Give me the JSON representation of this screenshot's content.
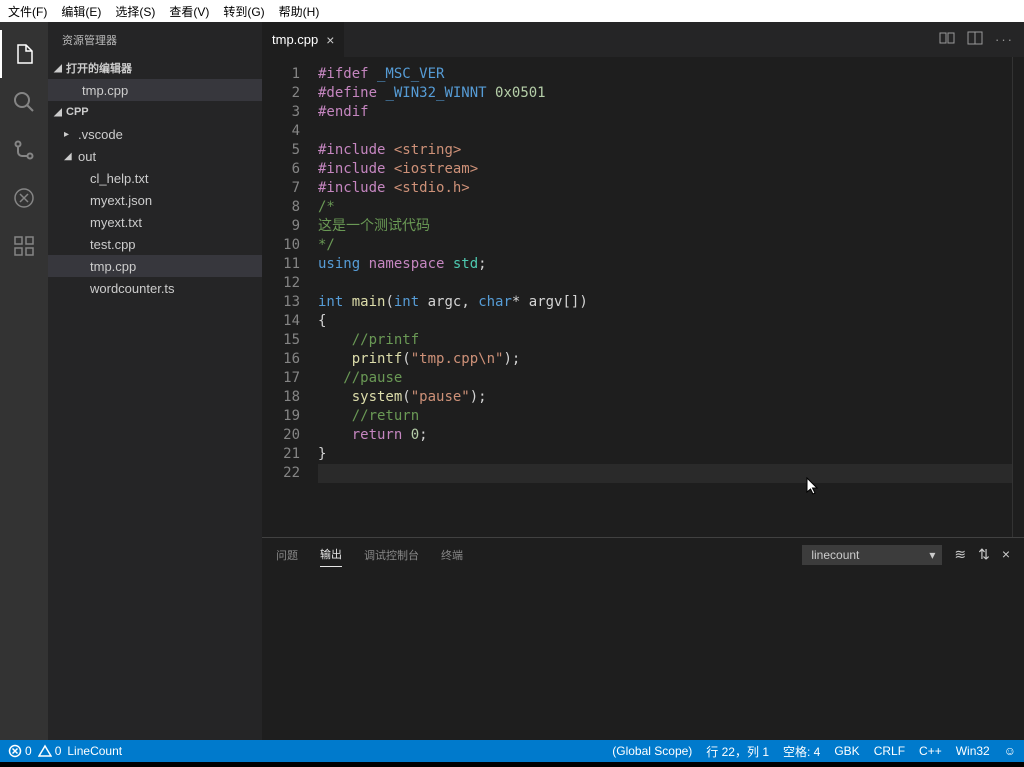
{
  "menubar": [
    "文件(F)",
    "编辑(E)",
    "选择(S)",
    "查看(V)",
    "转到(G)",
    "帮助(H)"
  ],
  "sidebar": {
    "title": "资源管理器",
    "openEditors": {
      "label": "打开的编辑器",
      "items": [
        "tmp.cpp"
      ]
    },
    "workspace": {
      "label": "CPP",
      "tree": [
        {
          "label": ".vscode",
          "type": "folder",
          "expanded": false,
          "indent": 1
        },
        {
          "label": "out",
          "type": "folder",
          "expanded": true,
          "indent": 1
        },
        {
          "label": "cl_help.txt",
          "type": "file",
          "indent": 2
        },
        {
          "label": "myext.json",
          "type": "file",
          "indent": 2
        },
        {
          "label": "myext.txt",
          "type": "file",
          "indent": 2
        },
        {
          "label": "test.cpp",
          "type": "file",
          "indent": 2
        },
        {
          "label": "tmp.cpp",
          "type": "file",
          "indent": 2,
          "selected": true
        },
        {
          "label": "wordcounter.ts",
          "type": "file",
          "indent": 2
        }
      ]
    }
  },
  "tab": {
    "name": "tmp.cpp"
  },
  "code": {
    "lines": [
      {
        "n": 1,
        "seg": [
          [
            "kw",
            "#ifdef"
          ],
          [
            "",
            ""
          ],
          [
            "mac",
            " _MSC_VER"
          ]
        ]
      },
      {
        "n": 2,
        "seg": [
          [
            "kw",
            "#define"
          ],
          [
            "mac",
            " _WIN32_WINNT"
          ],
          [
            "",
            " "
          ],
          [
            "num",
            "0x0501"
          ]
        ]
      },
      {
        "n": 3,
        "seg": [
          [
            "kw",
            "#endif"
          ]
        ]
      },
      {
        "n": 4,
        "seg": [
          [
            "",
            ""
          ]
        ]
      },
      {
        "n": 5,
        "seg": [
          [
            "kw",
            "#include"
          ],
          [
            "",
            " "
          ],
          [
            "str",
            "<string>"
          ]
        ]
      },
      {
        "n": 6,
        "seg": [
          [
            "kw",
            "#include"
          ],
          [
            "",
            " "
          ],
          [
            "str",
            "<iostream>"
          ]
        ]
      },
      {
        "n": 7,
        "seg": [
          [
            "kw",
            "#include"
          ],
          [
            "",
            " "
          ],
          [
            "str",
            "<stdio.h>"
          ]
        ]
      },
      {
        "n": 8,
        "seg": [
          [
            "cmt",
            "/*"
          ]
        ]
      },
      {
        "n": 9,
        "seg": [
          [
            "cmt",
            "这是一个测试代码"
          ]
        ]
      },
      {
        "n": 10,
        "seg": [
          [
            "cmt",
            "*/"
          ]
        ]
      },
      {
        "n": 11,
        "seg": [
          [
            "typ",
            "using "
          ],
          [
            "kw",
            "namespace "
          ],
          [
            "ns",
            "std"
          ],
          [
            "",
            ";"
          ]
        ]
      },
      {
        "n": 12,
        "seg": [
          [
            "",
            ""
          ]
        ]
      },
      {
        "n": 13,
        "seg": [
          [
            "typ",
            "int "
          ],
          [
            "fn",
            "main"
          ],
          [
            "",
            "("
          ],
          [
            "typ",
            "int"
          ],
          [
            "",
            " argc, "
          ],
          [
            "typ",
            "char"
          ],
          [
            "",
            "* argv[])"
          ]
        ]
      },
      {
        "n": 14,
        "seg": [
          [
            "",
            "{"
          ]
        ]
      },
      {
        "n": 15,
        "seg": [
          [
            "",
            "    "
          ],
          [
            "cmt",
            "//printf"
          ]
        ]
      },
      {
        "n": 16,
        "seg": [
          [
            "",
            "    "
          ],
          [
            "fn",
            "printf"
          ],
          [
            "",
            "("
          ],
          [
            "str",
            "\"tmp.cpp\\n\""
          ],
          [
            "",
            ");"
          ]
        ]
      },
      {
        "n": 17,
        "seg": [
          [
            "",
            "   "
          ],
          [
            "cmt",
            "//pause"
          ]
        ]
      },
      {
        "n": 18,
        "seg": [
          [
            "",
            "    "
          ],
          [
            "fn",
            "system"
          ],
          [
            "",
            "("
          ],
          [
            "str",
            "\"pause\""
          ],
          [
            "",
            ");"
          ]
        ]
      },
      {
        "n": 19,
        "seg": [
          [
            "",
            "    "
          ],
          [
            "cmt",
            "//return"
          ]
        ]
      },
      {
        "n": 20,
        "seg": [
          [
            "",
            "    "
          ],
          [
            "kw",
            "return"
          ],
          [
            "",
            " "
          ],
          [
            "num",
            "0"
          ],
          [
            "",
            ";"
          ]
        ]
      },
      {
        "n": 21,
        "seg": [
          [
            "",
            "}"
          ]
        ]
      },
      {
        "n": 22,
        "seg": [
          [
            "",
            ""
          ]
        ],
        "current": true
      }
    ]
  },
  "panel": {
    "tabs": [
      "问题",
      "输出",
      "调试控制台",
      "终端"
    ],
    "active": 1,
    "select": "linecount"
  },
  "status": {
    "errors": "0",
    "warnings": "0",
    "linecount": "LineCount",
    "scope": "(Global Scope)",
    "pos": "行 22，列 1",
    "spaces": "空格: 4",
    "encoding": "GBK",
    "eol": "CRLF",
    "lang": "C++",
    "target": "Win32"
  }
}
